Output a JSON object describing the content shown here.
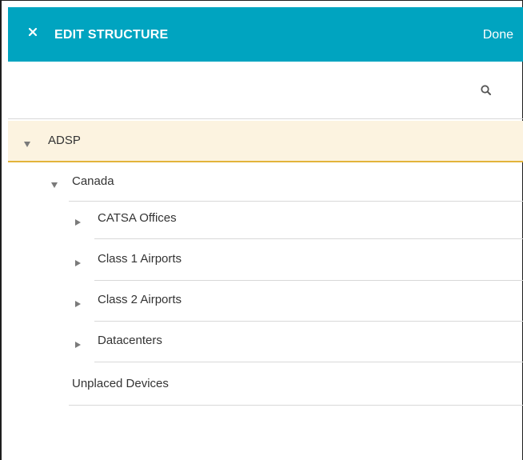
{
  "header": {
    "title": "EDIT STRUCTURE",
    "done_label": "Done",
    "close_icon": "close-icon",
    "background": "#00a4c0"
  },
  "search": {
    "value": "",
    "placeholder": "",
    "icon": "search-icon"
  },
  "tree": {
    "root": {
      "label": "ADSP",
      "expanded": true,
      "selected": true,
      "highlight_bg": "#fcf3e0",
      "highlight_border": "#e3b43a"
    },
    "country": {
      "label": "Canada",
      "expanded": true
    },
    "children": [
      {
        "label": "CATSA Offices",
        "expanded": false
      },
      {
        "label": "Class 1 Airports",
        "expanded": false
      },
      {
        "label": "Class 2 Airports",
        "expanded": false
      },
      {
        "label": "Datacenters",
        "expanded": false
      }
    ],
    "unplaced": {
      "label": "Unplaced Devices"
    }
  }
}
